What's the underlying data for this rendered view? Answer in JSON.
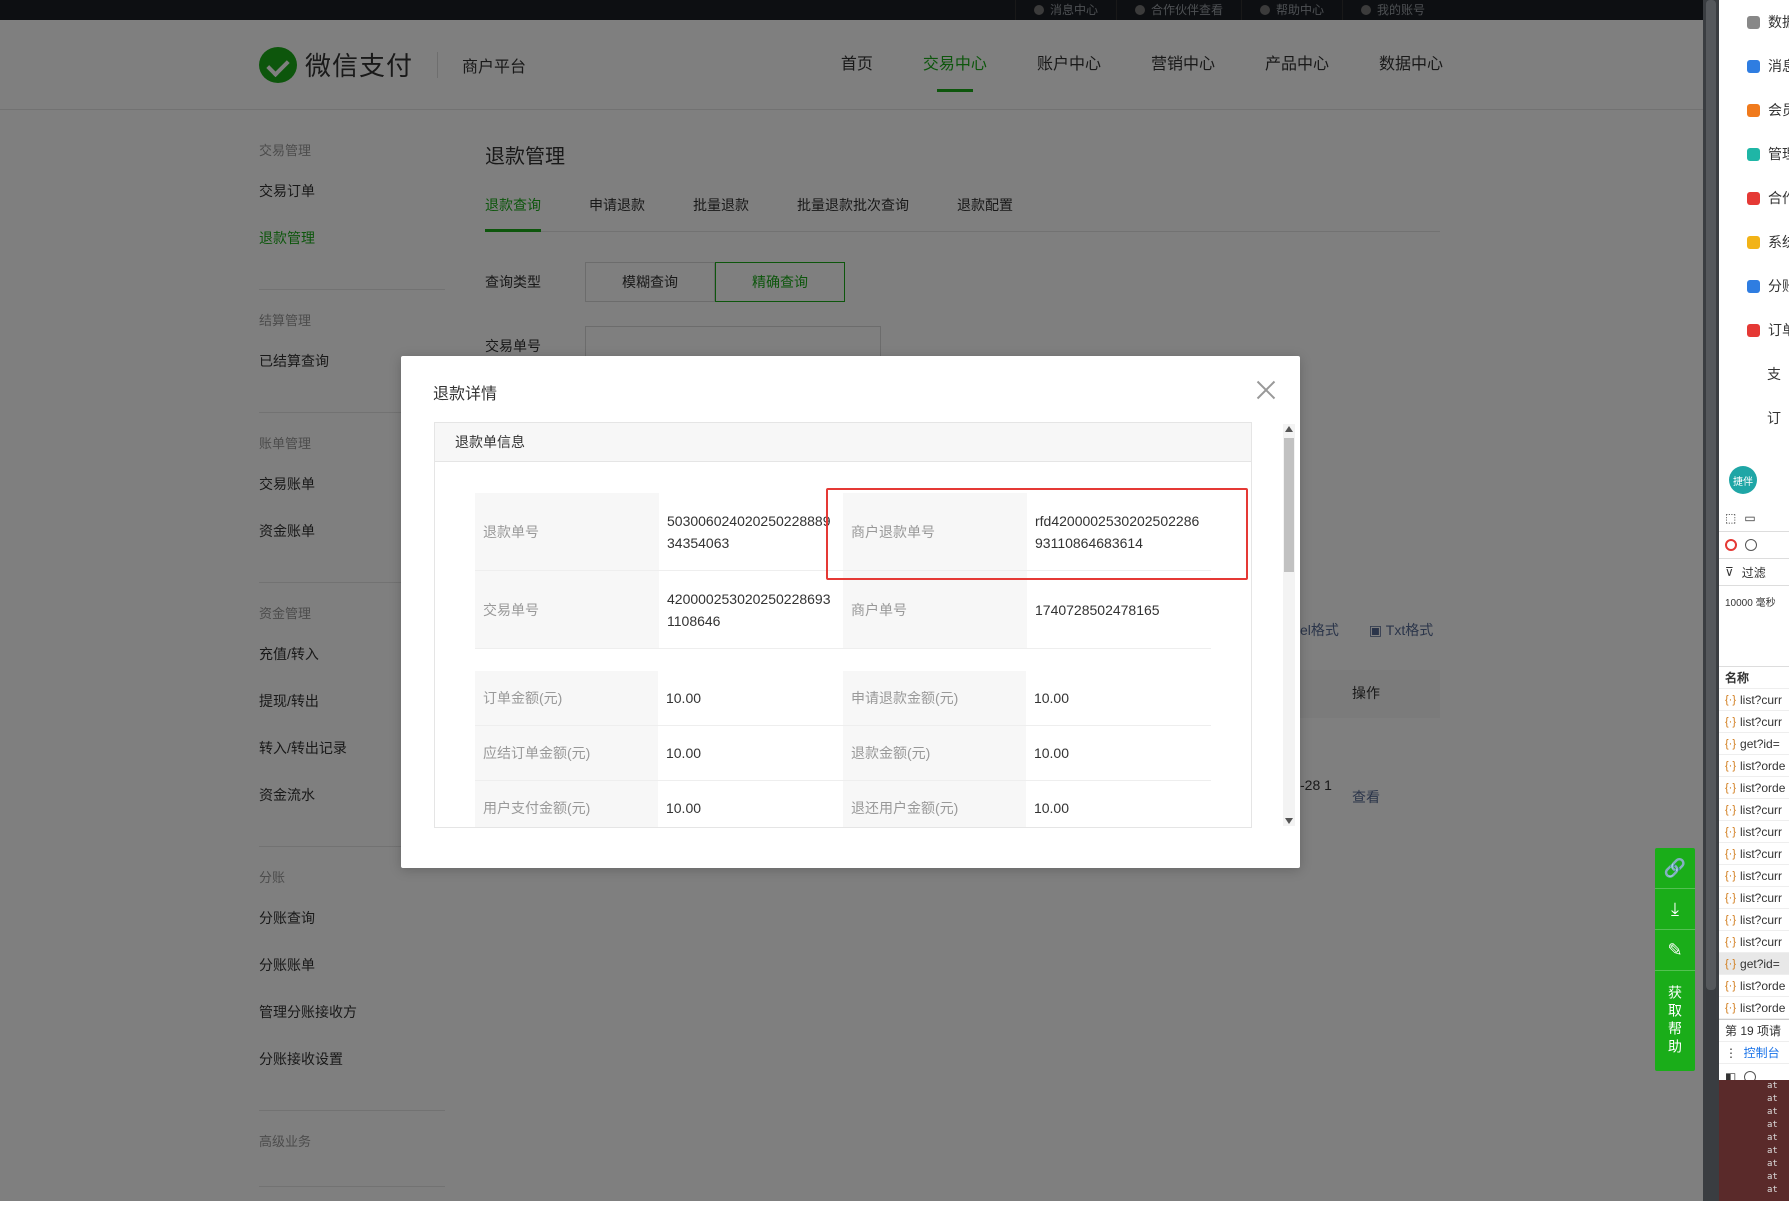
{
  "topbar": {
    "links": [
      "消息中心",
      "合作伙伴查看",
      "帮助中心",
      "我的账号"
    ]
  },
  "header": {
    "logo_text": "微信支付",
    "sub_title": "商户平台",
    "nav": [
      "首页",
      "交易中心",
      "账户中心",
      "营销中心",
      "产品中心",
      "数据中心"
    ],
    "active_nav": "交易中心"
  },
  "sidebar": {
    "groups": [
      {
        "title": "交易管理",
        "items": [
          "交易订单",
          "退款管理"
        ]
      },
      {
        "title": "结算管理",
        "items": [
          "已结算查询"
        ]
      },
      {
        "title": "账单管理",
        "items": [
          "交易账单",
          "资金账单"
        ]
      },
      {
        "title": "资金管理",
        "items": [
          "充值/转入",
          "提现/转出",
          "转入/转出记录",
          "资金流水"
        ]
      },
      {
        "title": "分账",
        "items": [
          "分账查询",
          "分账账单",
          "管理分账接收方",
          "分账接收设置"
        ]
      },
      {
        "title": "高级业务",
        "items": []
      }
    ],
    "active_item": "退款管理"
  },
  "main": {
    "title": "退款管理",
    "tabs": [
      "退款查询",
      "申请退款",
      "批量退款",
      "批量退款批次查询",
      "退款配置"
    ],
    "query_type_label": "查询类型",
    "query_types": [
      "模糊查询",
      "精确查询"
    ],
    "txn_label": "交易单号",
    "export_excel": "el格式",
    "export_txt": "Txt格式",
    "op_label": "操作",
    "date_fragment": "-28 1",
    "view_link": "查看"
  },
  "modal": {
    "title": "退款详情",
    "section": "退款单信息",
    "info": {
      "refund_no_label": "退款单号",
      "refund_no": "50300602402025022888934354063",
      "merchant_refund_no_label": "商户退款单号",
      "merchant_refund_no": "rfd420000253020250228693110864683614",
      "txn_no_label": "交易单号",
      "txn_no": "4200002530202502286931108646",
      "merchant_order_label": "商户单号",
      "merchant_order": "1740728502478165"
    },
    "amounts": [
      {
        "k1": "订单金额(元)",
        "v1": "10.00",
        "k2": "申请退款金额(元)",
        "v2": "10.00"
      },
      {
        "k1": "应结订单金额(元)",
        "v1": "10.00",
        "k2": "退款金额(元)",
        "v2": "10.00"
      },
      {
        "k1": "用户支付金额(元)",
        "v1": "10.00",
        "k2": "退还用户金额(元)",
        "v2": "10.00"
      }
    ]
  },
  "float_tools": {
    "help": "获取帮助"
  },
  "devtools": {
    "ext_items": [
      "数据",
      "消息",
      "会员",
      "管理",
      "合作",
      "系统",
      "分账",
      "订单",
      "支",
      "订"
    ],
    "assistant_badge": "捷伴",
    "filter_label": "过滤",
    "throttle": "10000 毫秒",
    "name_header": "名称",
    "requests": [
      "list?curr",
      "list?curr",
      "get?id=",
      "list?orde",
      "list?orde",
      "list?curr",
      "list?curr",
      "list?curr",
      "list?curr",
      "list?curr",
      "list?curr",
      "list?curr",
      "get?id=",
      "list?orde",
      "list?orde"
    ],
    "status": "第 19 项请",
    "console_tab": "控制台"
  }
}
